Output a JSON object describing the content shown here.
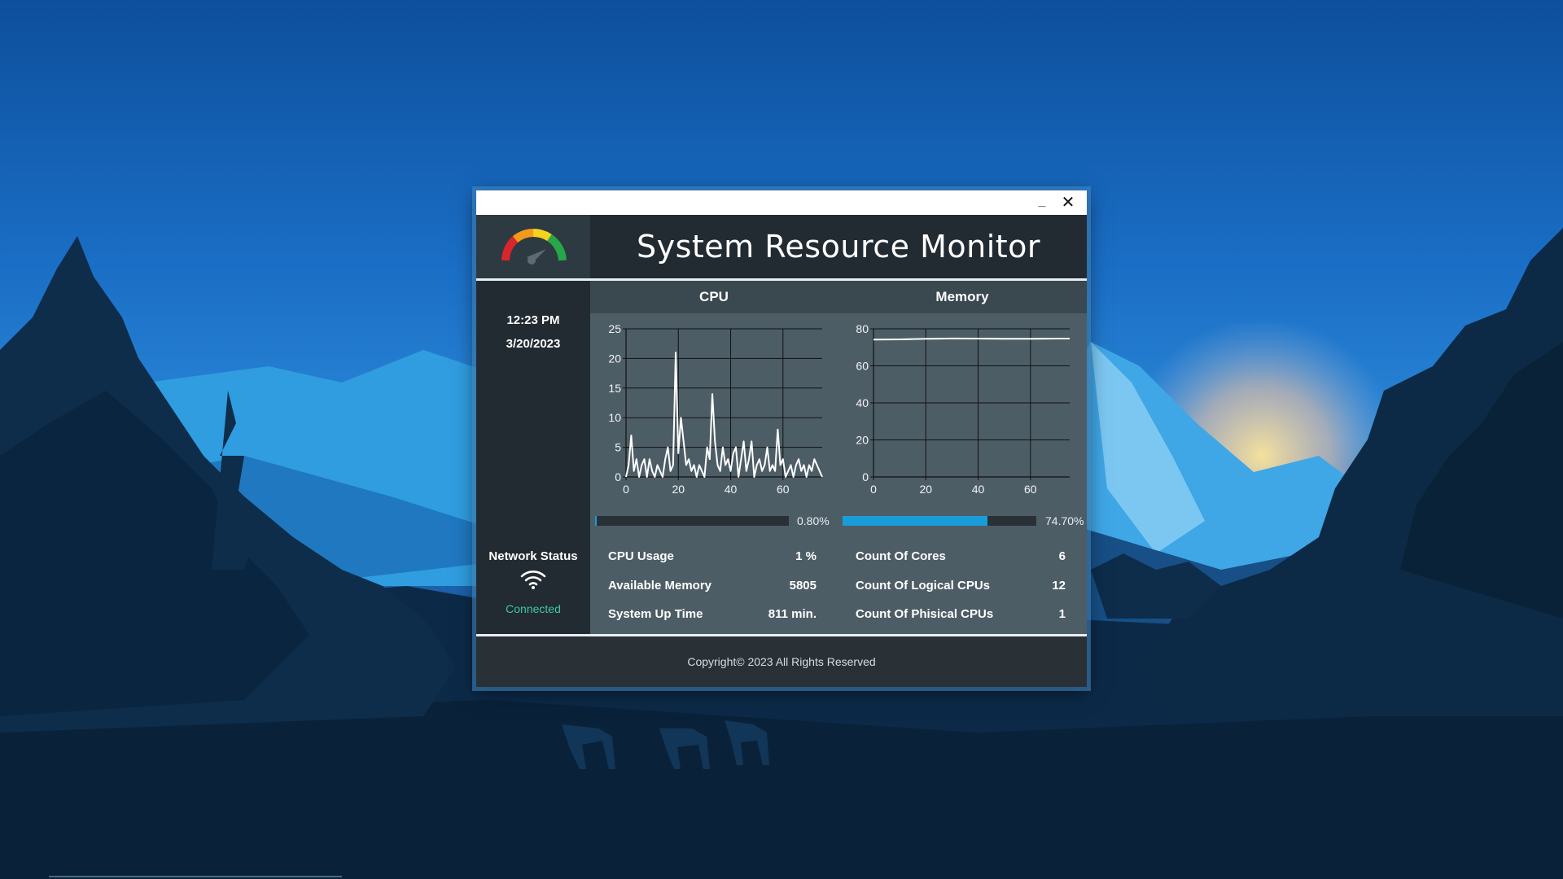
{
  "window": {
    "minimize_label": "_",
    "close_label": "✕",
    "title": "System Resource Monitor",
    "logo_icon": "gauge-icon"
  },
  "datetime": {
    "time": "12:23 PM",
    "date": "3/20/2023"
  },
  "cpu": {
    "header": "CPU",
    "usage_bar_fraction": 0.008,
    "usage_percent_label": "0.80%"
  },
  "memory": {
    "header": "Memory",
    "usage_bar_fraction": 0.747,
    "usage_percent_label": "74.70%"
  },
  "network": {
    "title": "Network Status",
    "icon": "wifi-icon",
    "status": "Connected",
    "status_color": "#3fc7a0"
  },
  "stats_cpu": [
    {
      "label": "CPU Usage",
      "value": "1 %"
    },
    {
      "label": "Available Memory",
      "value": "5805"
    },
    {
      "label": "System Up Time",
      "value": "811 min."
    }
  ],
  "stats_system": [
    {
      "label": "Count Of Cores",
      "value": "6"
    },
    {
      "label": "Count Of Logical CPUs",
      "value": "12"
    },
    {
      "label": "Count Of Phisical CPUs",
      "value": "1"
    }
  ],
  "footer": {
    "copyright": "Copyright© 2023 All Rights Reserved"
  },
  "colors": {
    "accent_bar": "#1a9cd8",
    "line": "#ffffff"
  },
  "chart_data": [
    {
      "type": "line",
      "title": "",
      "xlim": [
        0,
        75
      ],
      "ylim": [
        0,
        25
      ],
      "xticks": [
        0,
        20,
        40,
        60
      ],
      "yticks": [
        0,
        5,
        10,
        15,
        20,
        25
      ],
      "grid": true,
      "series": [
        {
          "x": [
            0,
            1,
            2,
            3,
            4,
            5,
            6,
            7,
            8,
            9,
            10,
            11,
            12,
            13,
            14,
            15,
            16,
            17,
            18,
            19,
            20,
            21,
            22,
            23,
            24,
            25,
            26,
            27,
            28,
            29,
            30,
            31,
            32,
            33,
            34,
            35,
            36,
            37,
            38,
            39,
            40,
            41,
            42,
            43,
            44,
            45,
            46,
            47,
            48,
            49,
            50,
            51,
            52,
            53,
            54,
            55,
            56,
            57,
            58,
            59,
            60,
            61,
            62,
            63,
            64,
            65,
            66,
            67,
            68,
            69,
            70,
            71,
            72,
            73,
            74,
            75
          ],
          "values": [
            0,
            2,
            7,
            1,
            3,
            0,
            2,
            3,
            0,
            3,
            1,
            0,
            2,
            1,
            0,
            3,
            5,
            1,
            2,
            21,
            4,
            10,
            6,
            2,
            3,
            1,
            2,
            0,
            2,
            1,
            0,
            5,
            3,
            14,
            6,
            2,
            1,
            5,
            2,
            3,
            1,
            4,
            5,
            0,
            3,
            6,
            1,
            3,
            6,
            0,
            2,
            3,
            1,
            2,
            5,
            1,
            2,
            1,
            8,
            2,
            3,
            0,
            1,
            2,
            0,
            2,
            3,
            1,
            2,
            0,
            2,
            1,
            3,
            2,
            1,
            0
          ]
        }
      ]
    },
    {
      "type": "line",
      "title": "",
      "xlim": [
        0,
        75
      ],
      "ylim": [
        0,
        80
      ],
      "xticks": [
        0,
        20,
        40,
        60
      ],
      "yticks": [
        0,
        20,
        40,
        60,
        80
      ],
      "grid": true,
      "series": [
        {
          "x": [
            0,
            10,
            20,
            30,
            40,
            50,
            60,
            70,
            75
          ],
          "values": [
            74.2,
            74.3,
            74.6,
            74.8,
            74.7,
            74.6,
            74.6,
            74.7,
            74.7
          ]
        }
      ]
    }
  ]
}
